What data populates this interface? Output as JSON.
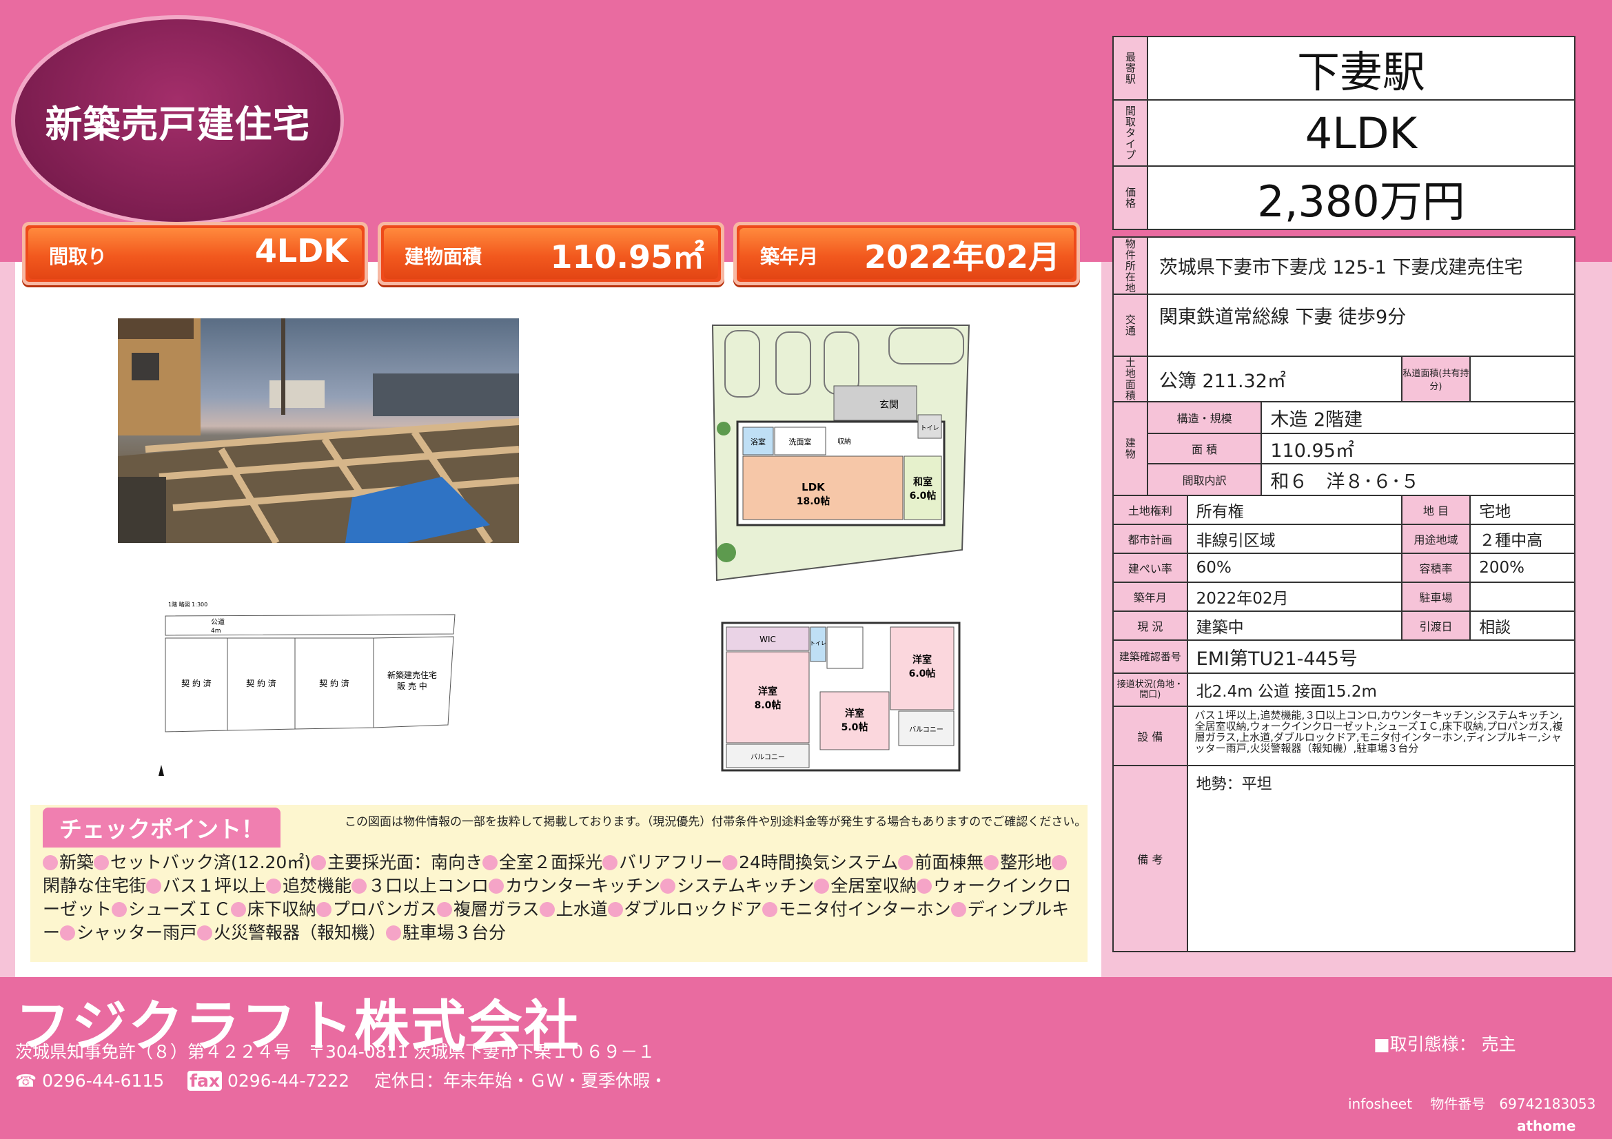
{
  "badge": "新築売戸建住宅",
  "chips": [
    {
      "label": "間取り",
      "value": "4LDK"
    },
    {
      "label": "建物面積",
      "value": "110.95㎡"
    },
    {
      "label": "築年月",
      "value": "2022年02月"
    }
  ],
  "floorplan_1f": {
    "rooms": [
      "玄関",
      "トイレ",
      "浴室",
      "洗面室",
      "収納",
      "LDK",
      "18.0帖",
      "和室",
      "6.0帖"
    ]
  },
  "floorplan_2f": {
    "rooms": [
      "WIC",
      "トイレ",
      "洋室",
      "6.0帖",
      "洋室",
      "8.0帖",
      "洋室",
      "5.0帖",
      "バルコニー",
      "バルコニー"
    ]
  },
  "site_plan": {
    "title": "1階 略図 1:300",
    "road": "公道",
    "road_width": "4m",
    "lots": [
      "契 約 済",
      "契 約 済",
      "契 約 済",
      "新築建売住宅",
      "販 売 中"
    ]
  },
  "checkpoint": {
    "title": "チェックポイント！",
    "disclaimer": "この図面は物件情報の一部を抜粋して掲載しております。（現況優先）付帯条件や別途料金等が発生する場合もありますのでご確認ください。",
    "items": [
      "新築",
      "セットバック済(12.20㎡)",
      "主要採光面：南向き",
      "全室２面採光",
      "バリアフリー",
      "24時間換気システム",
      "前面棟無",
      "整形地",
      "閑静な住宅街",
      "バス１坪以上",
      "追焚機能",
      "３口以上コンロ",
      "カウンターキッチン",
      "システムキッチン",
      "全居室収納",
      "ウォークインクローゼット",
      "シューズＩＣ",
      "床下収納",
      "プロパンガス",
      "複層ガラス",
      "上水道",
      "ダブルロックドア",
      "モニタ付インターホン",
      "ディンプルキー",
      "シャッター雨戸",
      "火災警報器（報知機）",
      "駐車場３台分"
    ]
  },
  "summary": {
    "station_label": "最寄駅",
    "station": "下妻駅",
    "layout_label": "間取タイプ",
    "layout": "4LDK",
    "price_label": "価格",
    "price": "2,380万円"
  },
  "details": {
    "location_label": "物件所在地",
    "location": "茨城県下妻市下妻戊 125-1 下妻戊建売住宅",
    "transport_label": "交通",
    "transport": "関東鉄道常総線 下妻 徒歩9分",
    "land_area_label": "土地面積",
    "land_area": "公簿 211.32㎡",
    "private_road_label": "私道面積(共有持分)",
    "private_road": "",
    "building_label": "建物",
    "structure_label": "構造・規模",
    "structure": "木造 2階建",
    "area_label": "面 積",
    "area": "110.95㎡",
    "rooms_label": "間取内訳",
    "rooms": "和６　洋８･６･５",
    "land_rights_label": "土地権利",
    "land_rights": "所有権",
    "land_category_label": "地 目",
    "land_category": "宅地",
    "city_plan_label": "都市計画",
    "city_plan": "非線引区域",
    "zoning_label": "用途地域",
    "zoning": "２種中高",
    "coverage_label": "建ぺい率",
    "coverage": "60%",
    "far_label": "容積率",
    "far": "200%",
    "built_label": "築年月",
    "built": "2022年02月",
    "parking_label": "駐車場",
    "parking": "",
    "status_label": "現 況",
    "status": "建築中",
    "handover_label": "引渡日",
    "handover": "相談",
    "confirm_label": "建築確認番号",
    "confirm": "EMI第TU21-445号",
    "road_label": "接道状況(角地・間口)",
    "road": "北2.4m 公道 接面15.2m",
    "equipment_label": "設 備",
    "equipment": "バス１坪以上,追焚機能,３口以上コンロ,カウンターキッチン,システムキッチン,全居室収納,ウォークインクローゼット,シューズＩＣ,床下収納,プロパンガス,複層ガラス,上水道,ダブルロックドア,モニタ付インターホン,ディンプルキー,シャッター雨戸,火災警報器（報知機）,駐車場３台分",
    "remarks_label": "備 考",
    "remarks": "地勢：平坦"
  },
  "footer": {
    "company": "フジクラフト株式会社",
    "license": "茨城県知事免許（８）第４２２４号　〒304-0811 茨城県下妻市下栗１０６９－１",
    "tel": "0296-44-6115",
    "fax_label": "fax",
    "fax": "0296-44-7222",
    "holidays": "定休日：年末年始・ＧＷ・夏季休暇・",
    "deal_type": "■取引態様：  売主",
    "infosheet": "infosheet　 物件番号　69742183053",
    "athome": "athome"
  },
  "colors": {
    "pink": "#e96ba0",
    "light_pink": "#f6c3d8",
    "orange": "#ee4a1a",
    "plum": "#7c1d4f"
  }
}
